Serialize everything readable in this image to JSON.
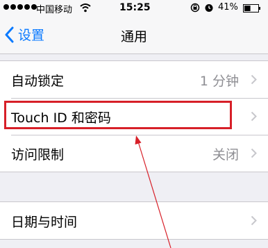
{
  "status_bar": {
    "carrier": "中国移动",
    "time": "15:25",
    "battery": "41%"
  },
  "nav": {
    "back_label": "设置",
    "title": "通用"
  },
  "group1": {
    "rows": [
      {
        "label": "自动锁定",
        "value": "1 分钟"
      },
      {
        "label": "Touch ID 和密码",
        "value": ""
      },
      {
        "label": "访问限制",
        "value": "关闭"
      }
    ]
  },
  "group2": {
    "rows": [
      {
        "label": "日期与时间",
        "value": ""
      }
    ]
  },
  "colors": {
    "accent": "#0a7aff",
    "highlight": "#d71f28",
    "secondary_text": "#8e8e93",
    "background": "#efeff4"
  },
  "icons": [
    "wifi-icon",
    "lock-rotation-icon",
    "alarm-icon",
    "battery-icon",
    "chevron-left-icon",
    "chevron-right-icon"
  ]
}
